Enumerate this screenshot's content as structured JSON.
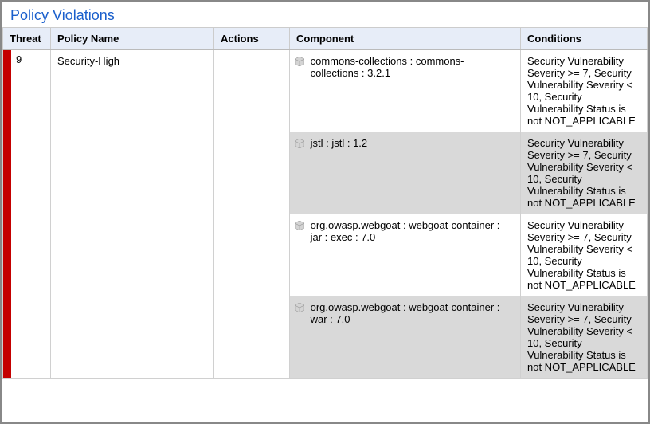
{
  "title": "Policy Violations",
  "columns": {
    "threat": "Threat",
    "policy": "Policy Name",
    "actions": "Actions",
    "component": "Component",
    "conditions": "Conditions"
  },
  "row": {
    "threat_value": "9",
    "threat_bar_color": "#c40000",
    "policy_name": "Security-High",
    "actions": "",
    "components": [
      {
        "name": "commons-collections : commons-collections : 3.2.1",
        "conditions": "Security Vulnerability Severity >= 7, Security Vulnerability Severity < 10, Security Vulnerability Status is not NOT_APPLICABLE"
      },
      {
        "name": "jstl : jstl : 1.2",
        "conditions": "Security Vulnerability Severity >= 7, Security Vulnerability Severity < 10, Security Vulnerability Status is not NOT_APPLICABLE"
      },
      {
        "name": "org.owasp.webgoat : webgoat-container : jar : exec : 7.0",
        "conditions": "Security Vulnerability Severity >= 7, Security Vulnerability Severity < 10, Security Vulnerability Status is not NOT_APPLICABLE"
      },
      {
        "name": "org.owasp.webgoat : webgoat-container : war : 7.0",
        "conditions": "Security Vulnerability Severity >= 7, Security Vulnerability Severity < 10, Security Vulnerability Status is not NOT_APPLICABLE"
      }
    ]
  }
}
